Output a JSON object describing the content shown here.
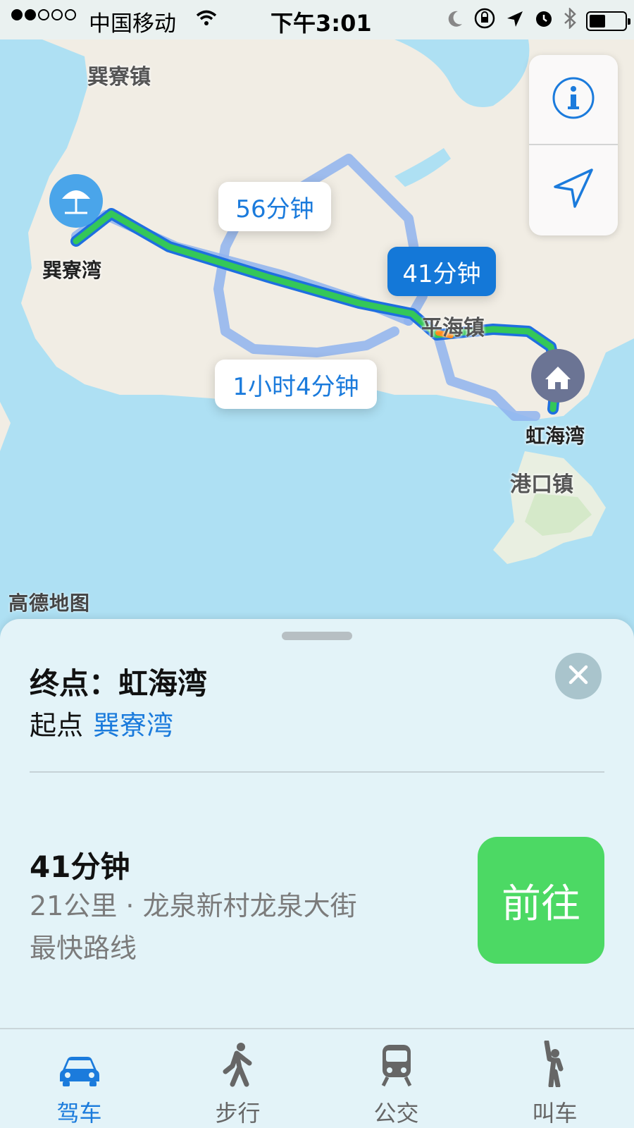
{
  "status_bar": {
    "carrier": "中国移动",
    "time": "下午3:01",
    "signal_filled": 2,
    "signal_total": 5,
    "battery_fraction": 0.45
  },
  "map": {
    "labels": {
      "town_north": "巽寮镇",
      "origin_pin": "巽寮湾",
      "middle_town": "平海镇",
      "dest_pin": "虹海湾",
      "south_town": "港口镇"
    },
    "routes": {
      "alt_north": "56分钟",
      "main": "41分钟",
      "alt_south": "1小时4分钟"
    },
    "provider_logo": "高德地图",
    "controls": {
      "info_icon": "info-icon",
      "location_icon": "location-arrow-icon"
    }
  },
  "card": {
    "destination_label": "终点：虹海湾",
    "origin_prefix": "起点",
    "origin_place": "巽寮湾",
    "duration": "41分钟",
    "distance_via": "21公里 · 龙泉新村龙泉大街",
    "route_note": "最快路线",
    "go_label": "前往"
  },
  "tabs": [
    {
      "label": "驾车",
      "icon": "car-icon",
      "active": true
    },
    {
      "label": "步行",
      "icon": "walk-icon",
      "active": false
    },
    {
      "label": "公交",
      "icon": "train-icon",
      "active": false
    },
    {
      "label": "叫车",
      "icon": "hail-icon",
      "active": false
    }
  ],
  "colors": {
    "accent": "#1b7bdc",
    "go_button": "#4cd964",
    "route_main": "#34c759",
    "route_alt": "#8fb3ef"
  }
}
